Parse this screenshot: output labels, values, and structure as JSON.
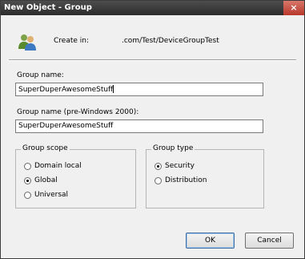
{
  "window": {
    "title": "New Object - Group",
    "close_glyph": "×"
  },
  "header": {
    "icon": "group-users-icon",
    "create_in_label": "Create in:",
    "create_in_path": ".com/Test/DeviceGroupTest"
  },
  "form": {
    "group_name_label": "Group name:",
    "group_name_value": "SuperDuperAwesomeStuff",
    "pre2000_label": "Group name (pre-Windows 2000):",
    "pre2000_value": "SuperDuperAwesomeStuff"
  },
  "scope": {
    "title": "Group scope",
    "options": [
      {
        "label": "Domain local",
        "selected": false
      },
      {
        "label": "Global",
        "selected": true
      },
      {
        "label": "Universal",
        "selected": false
      }
    ]
  },
  "type": {
    "title": "Group type",
    "options": [
      {
        "label": "Security",
        "selected": true
      },
      {
        "label": "Distribution",
        "selected": false
      }
    ]
  },
  "buttons": {
    "ok": "OK",
    "cancel": "Cancel"
  }
}
